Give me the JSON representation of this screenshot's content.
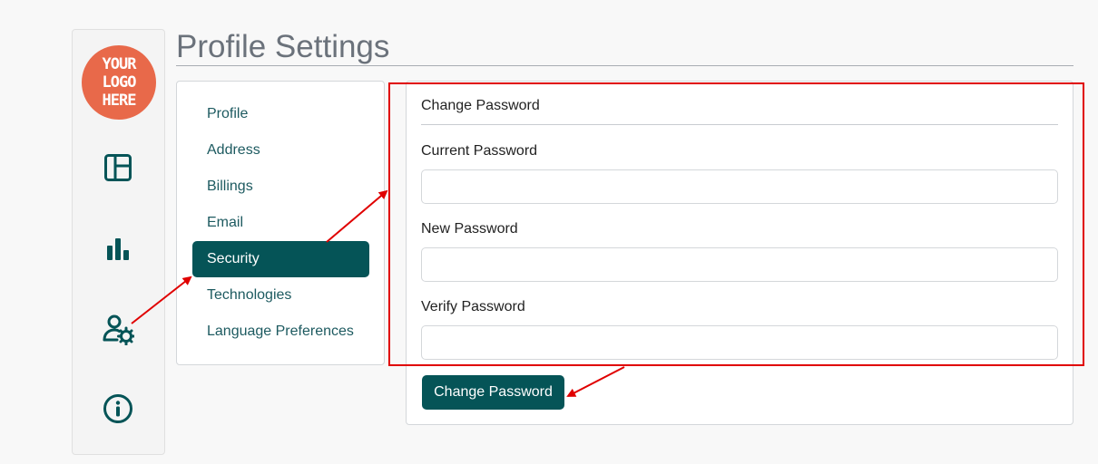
{
  "app": {
    "title": "Profile Settings",
    "logo_lines": [
      "YOUR",
      "LOGO",
      "HERE"
    ],
    "brand_color": "#055457",
    "logo_color": "#e8694a",
    "annotation_color": "#e00000"
  },
  "rail": {
    "icons": [
      {
        "name": "dashboard-layout-icon"
      },
      {
        "name": "bar-chart-icon"
      },
      {
        "name": "user-settings-icon"
      },
      {
        "name": "info-icon"
      }
    ]
  },
  "settings_nav": {
    "items": [
      {
        "label": "Profile",
        "active": false
      },
      {
        "label": "Address",
        "active": false
      },
      {
        "label": "Billings",
        "active": false
      },
      {
        "label": "Email",
        "active": false
      },
      {
        "label": "Security",
        "active": true
      },
      {
        "label": "Technologies",
        "active": false
      },
      {
        "label": "Language Preferences",
        "active": false
      }
    ]
  },
  "form": {
    "title": "Change Password",
    "fields": [
      {
        "label": "Current Password",
        "value": "",
        "placeholder": ""
      },
      {
        "label": "New Password",
        "value": "",
        "placeholder": ""
      },
      {
        "label": "Verify Password",
        "value": "",
        "placeholder": ""
      }
    ],
    "submit_label": "Change Password"
  }
}
